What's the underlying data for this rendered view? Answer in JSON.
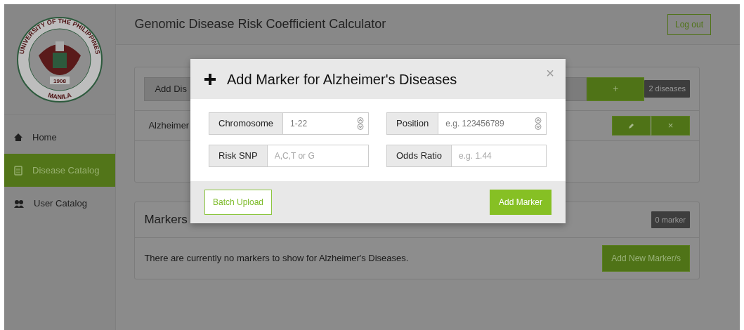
{
  "sidebar": {
    "logo": {
      "top_text": "UNIVERSITY OF THE PHILIPPINES",
      "bottom_text": "MANILA",
      "year": "1908"
    },
    "items": [
      {
        "label": "Home",
        "kind": "home",
        "selected": false
      },
      {
        "label": "Disease Catalog",
        "kind": "clipboard",
        "selected": true
      },
      {
        "label": "User Catalog",
        "kind": "users",
        "selected": false
      }
    ]
  },
  "header": {
    "title": "Genomic Disease Risk Coefficient Calculator",
    "logout": "Log out"
  },
  "disease_panel": {
    "add_label": "Add Dis",
    "add_button": "+",
    "count": "2 diseases",
    "rows": [
      {
        "name": "Alzheimer",
        "delete": "×"
      }
    ]
  },
  "markers_panel": {
    "title": "Markers",
    "count": "0 marker",
    "message": "There are currently no markers to show for Alzheimer's Diseases.",
    "button": "Add New Marker/s"
  },
  "modal": {
    "title": "Add Marker for Alzheimer's Diseases",
    "close": "×",
    "fields": [
      {
        "label": "Chromosome",
        "placeholder": "1-22",
        "kind": "number"
      },
      {
        "label": "Position",
        "placeholder": "e.g. 123456789",
        "kind": "number"
      },
      {
        "label": "Risk SNP",
        "placeholder": "A,C,T or G",
        "kind": "text"
      },
      {
        "label": "Odds Ratio",
        "placeholder": "e.g. 1.44",
        "kind": "text"
      }
    ],
    "buttons": [
      {
        "label": "Batch Upload",
        "kind": "outline"
      },
      {
        "label": "Add Marker",
        "kind": "primary"
      }
    ]
  }
}
